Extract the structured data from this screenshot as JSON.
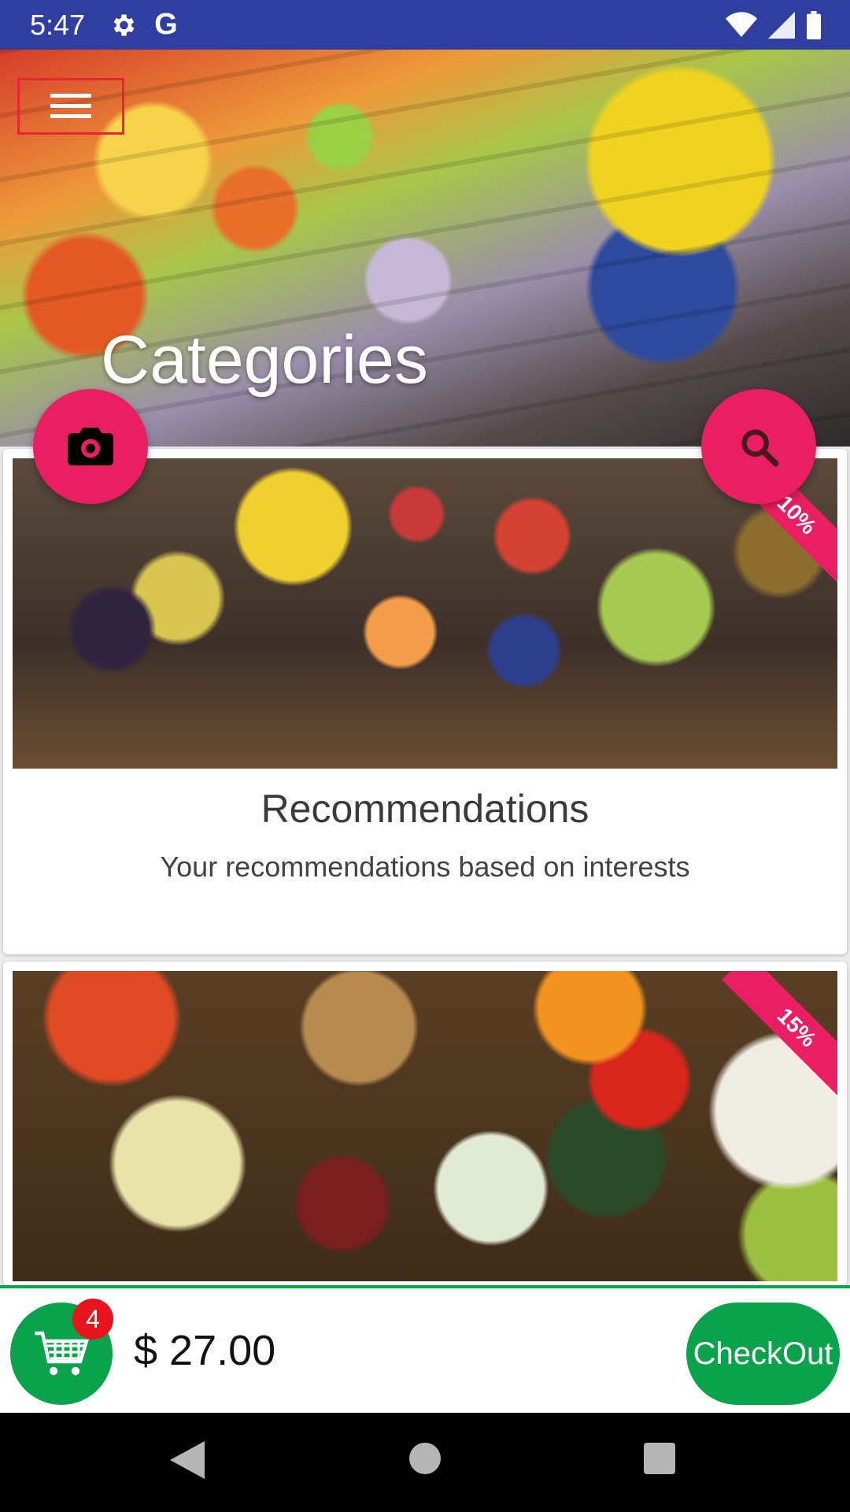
{
  "status_bar": {
    "time": "5:47",
    "icons": [
      "gear-icon",
      "google-icon",
      "wifi-icon",
      "signal-icon",
      "battery-icon"
    ],
    "g_letter": "G"
  },
  "header": {
    "title": "Categories",
    "menu_icon": "hamburger-menu-icon",
    "image": "supermarket-shopper"
  },
  "fabs": {
    "camera_icon": "camera-icon",
    "search_icon": "search-icon",
    "color": "#e91e63"
  },
  "cards": [
    {
      "title": "Recommendations",
      "subtitle": "Your recommendations based on interests",
      "discount": "10%",
      "image": "fruit-assortment"
    },
    {
      "title": "",
      "subtitle": "",
      "discount": "15%",
      "image": "vegetable-assortment"
    }
  ],
  "bottom_bar": {
    "cart_count": "4",
    "total": "$ 27.00",
    "checkout_label": "CheckOut",
    "accent": "#0aa24b"
  },
  "nav_bar": {
    "buttons": [
      "back",
      "home",
      "recents"
    ]
  }
}
